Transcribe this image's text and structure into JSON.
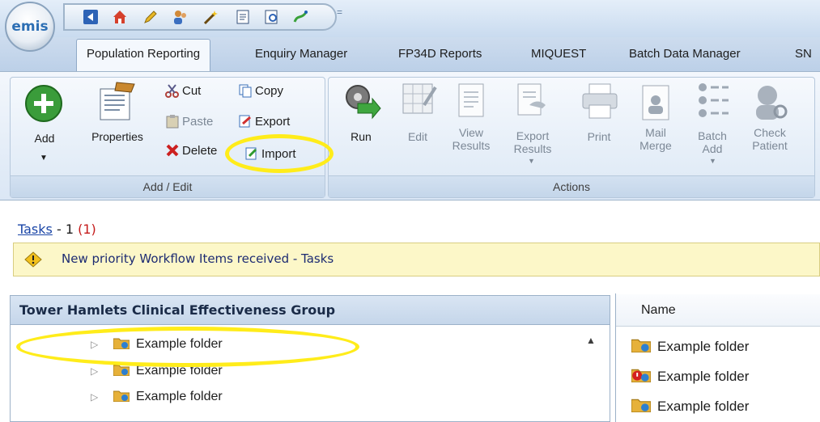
{
  "app": {
    "logo_text": "emis"
  },
  "quick_access": {
    "icons": [
      "back-icon",
      "home-icon",
      "pencil-icon",
      "users-icon",
      "wand-icon",
      "document-icon",
      "preview-icon",
      "chart-icon"
    ],
    "more_glyph": "="
  },
  "tabs": [
    {
      "label": "Population Reporting",
      "active": true
    },
    {
      "label": "Enquiry Manager"
    },
    {
      "label": "FP34D Reports"
    },
    {
      "label": "MIQUEST"
    },
    {
      "label": "Batch Data Manager"
    },
    {
      "label": "SN"
    }
  ],
  "ribbon": {
    "add_edit": {
      "label": "Add / Edit",
      "add": "Add",
      "properties": "Properties",
      "cut": "Cut",
      "paste": "Paste",
      "delete": "Delete",
      "copy": "Copy",
      "export": "Export",
      "import": "Import"
    },
    "actions": {
      "label": "Actions",
      "run": "Run",
      "edit": "Edit",
      "view_results": [
        "View",
        "Results"
      ],
      "export_results": [
        "Export",
        "Results"
      ],
      "print": "Print",
      "mail_merge": [
        "Mail",
        "Merge"
      ],
      "batch_add": [
        "Batch",
        "Add"
      ],
      "check_patient": [
        "Check",
        "Patient"
      ]
    }
  },
  "tasks": {
    "link": "Tasks",
    "count": " - 1 ",
    "priority": "(1)"
  },
  "notice": {
    "text": "New priority Workflow Items received - Tasks"
  },
  "tree": {
    "title": "Tower Hamlets Clinical Effectiveness Group",
    "items": [
      {
        "label": "Example folder"
      },
      {
        "label": "Example folder"
      },
      {
        "label": "Example folder"
      }
    ]
  },
  "list": {
    "column": "Name",
    "items": [
      {
        "label": "Example folder",
        "icon": "folder-icon"
      },
      {
        "label": "Example folder",
        "icon": "folder-alert-icon"
      },
      {
        "label": "Example folder",
        "icon": "folder-icon"
      }
    ]
  },
  "colors": {
    "highlight": "#ffec1a",
    "link": "#1b46a7",
    "priority": "#c41a1a",
    "notice_bg": "#fcf7c8"
  }
}
